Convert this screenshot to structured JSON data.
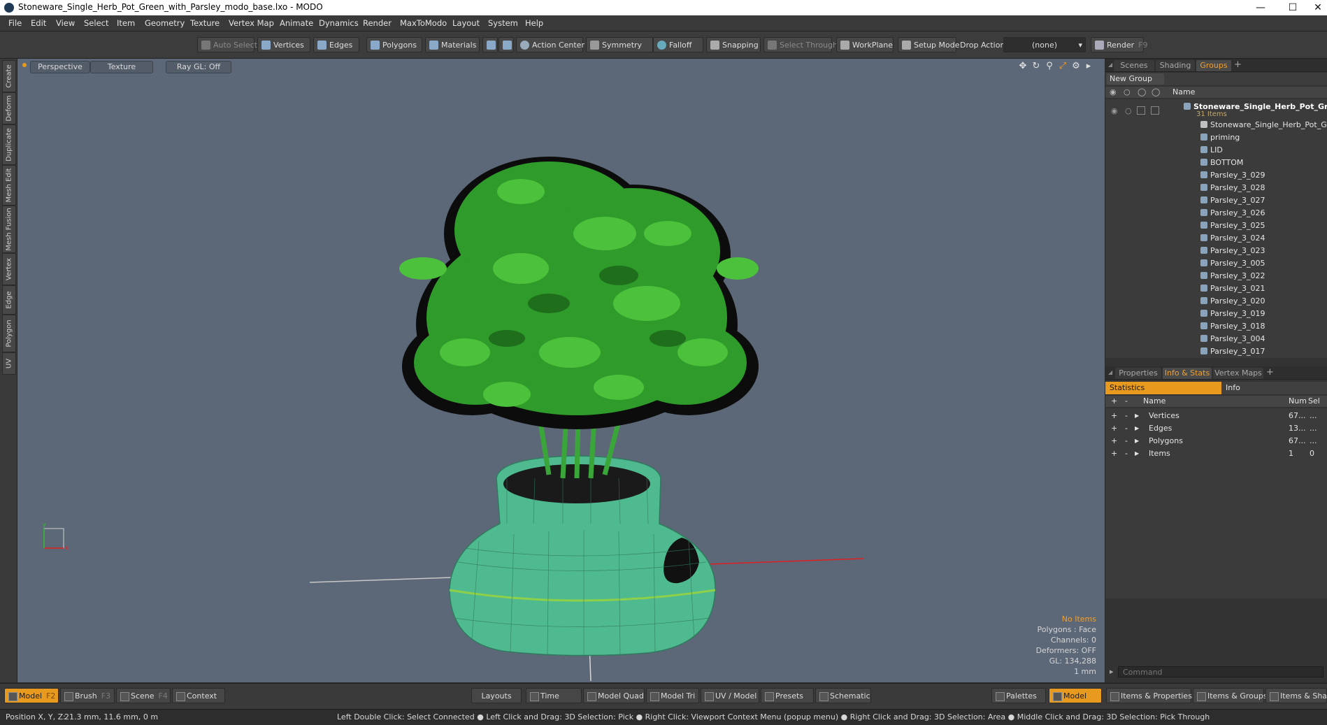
{
  "window": {
    "title": "Stoneware_Single_Herb_Pot_Green_with_Parsley_modo_base.lxo - MODO"
  },
  "menu": [
    "File",
    "Edit",
    "View",
    "Select",
    "Item",
    "Geometry",
    "Texture",
    "Vertex Map",
    "Animate",
    "Dynamics",
    "Render",
    "MaxToModo",
    "Layout",
    "System",
    "Help"
  ],
  "toolbar": {
    "auto_select": "Auto Select",
    "vertices": "Vertices",
    "edges": "Edges",
    "polygons": "Polygons",
    "materials": "Materials",
    "action_center": "Action Center",
    "symmetry": "Symmetry",
    "falloff": "Falloff",
    "snapping": "Snapping",
    "select_through": "Select Through",
    "workplane": "WorkPlane",
    "setup_mode": "Setup Mode",
    "drop_action": "Drop Action",
    "drop_value": "(none)",
    "render": "Render",
    "render_hotkey": "F9"
  },
  "left_tabs": [
    "Create",
    "Deform",
    "Duplicate",
    "Mesh Edit",
    "Mesh Fusion",
    "Vertex",
    "Edge",
    "Polygon",
    "UV"
  ],
  "viewport": {
    "perspective": "Perspective",
    "texture": "Texture",
    "raygl": "Ray GL: Off",
    "info": {
      "no_items": "No Items",
      "polygons": "Polygons : Face",
      "channels": "Channels: 0",
      "deformers": "Deformers: OFF",
      "gl": "GL: 134,288",
      "scale": "1 mm"
    }
  },
  "scene_panel": {
    "tabs": [
      "Scenes",
      "Shading",
      "Groups"
    ],
    "new_group": "New Group",
    "col_name": "Name",
    "root_name": "Stoneware_Single_Herb_Pot_Gr...",
    "root_count": "31 Items",
    "items": [
      "Stoneware_Single_Herb_Pot_Gree ...",
      "priming",
      "LID",
      "BOTTOM",
      "Parsley_3_029",
      "Parsley_3_028",
      "Parsley_3_027",
      "Parsley_3_026",
      "Parsley_3_025",
      "Parsley_3_024",
      "Parsley_3_023",
      "Parsley_3_005",
      "Parsley_3_022",
      "Parsley_3_021",
      "Parsley_3_020",
      "Parsley_3_019",
      "Parsley_3_018",
      "Parsley_3_004",
      "Parsley_3_017"
    ]
  },
  "info_panel": {
    "tabs": [
      "Properties",
      "Info & Stats",
      "Vertex Maps"
    ],
    "statistics": "Statistics",
    "info": "Info",
    "col_name": "Name",
    "col_num": "Num",
    "col_sel": "Sel",
    "rows": [
      {
        "name": "Vertices",
        "num": "67...",
        "sel": "..."
      },
      {
        "name": "Edges",
        "num": "13...",
        "sel": "..."
      },
      {
        "name": "Polygons",
        "num": "67...",
        "sel": "..."
      },
      {
        "name": "Items",
        "num": "1",
        "sel": "0"
      }
    ],
    "command_placeholder": "Command"
  },
  "bottom": {
    "model": "Model",
    "model_key": "F2",
    "brush": "Brush",
    "brush_key": "F3",
    "scene": "Scene",
    "scene_key": "F4",
    "context": "Context",
    "layouts": "Layouts",
    "time": "Time",
    "model_quad": "Model Quad",
    "model_tri": "Model Tri",
    "uv_model": "UV / Model",
    "presets": "Presets",
    "schematic": "Schematic",
    "palettes": "Palettes",
    "model2": "Model",
    "items_props": "Items & Properties",
    "items_groups": "Items & Groups",
    "items_shading": "Items & Shadin"
  },
  "status": {
    "position_label": "Position X, Y, Z:",
    "position_value": "21.3 mm, 11.6 mm, 0 m",
    "hint": "Left Double Click: Select Connected ● Left Click and Drag: 3D Selection: Pick ● Right Click: Viewport Context Menu (popup menu) ● Right Click and Drag: 3D Selection: Area ● Middle Click and Drag: 3D Selection: Pick Through"
  },
  "colors": {
    "accent": "#e89a1e",
    "viewport_bg": "#5c6878",
    "pot": "#4fb98f",
    "leaf": "#2e9b2a"
  }
}
